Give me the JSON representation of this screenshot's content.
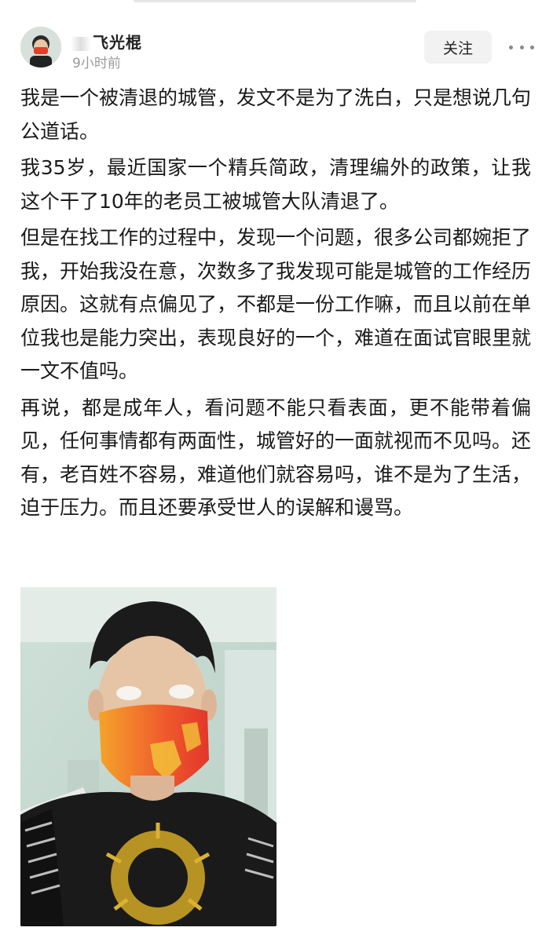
{
  "post": {
    "author_name": "飞光棍",
    "time": "9小时前",
    "follow_label": "关注",
    "paragraphs": [
      "我是一个被清退的城管，发文不是为了洗白，只是想说几句公道话。",
      "我35岁，最近国家一个精兵简政，清理编外的政策，让我这个干了10年的老员工被城管大队清退了。",
      "但是在找工作的过程中，发现一个问题，很多公司都婉拒了我，开始我没在意，次数多了我发现可能是城管的工作经历原因。这就有点偏见了，不都是一份工作嘛，而且以前在单位我也是能力突出，表现良好的一个，难道在面试官眼里就一文不值吗。",
      "再说，都是成年人，看问题不能只看表面，更不能带着偏见，任何事情都有两面性，城管好的一面就视而不见吗。还有，老百姓不容易，难道他们就容易吗，谁不是为了生活，迫于压力。而且还要承受世人的误解和谩骂。"
    ]
  },
  "icons": {
    "more": "more-dots-icon",
    "avatar": "avatar"
  },
  "colors": {
    "follow_bg": "#f2f2f2",
    "time_text": "#9a9a9a",
    "body_text": "#1a1a1a"
  }
}
